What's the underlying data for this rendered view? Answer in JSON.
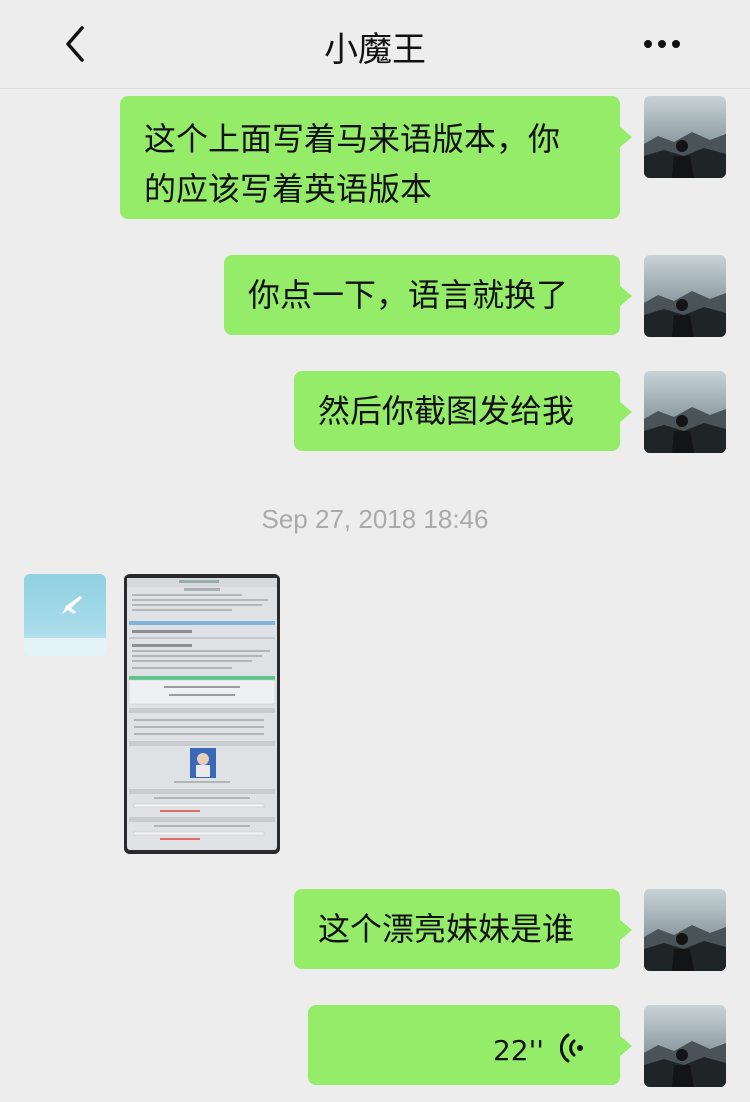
{
  "header": {
    "title": "小魔王"
  },
  "messages": {
    "m1": {
      "line1": "这个上面写着马来语版本，你",
      "line2": "的应该写着英语版本"
    },
    "m2": {
      "text": "你点一下，语言就换了"
    },
    "m3": {
      "text": "然后你截图发给我"
    },
    "timestamp": "Sep 27, 2018 18:46",
    "m5": {
      "text": "这个漂亮妹妹是谁"
    },
    "voice": {
      "duration": "22''"
    }
  },
  "icons": {
    "back": "chevron-left-icon",
    "more": "more-dots-icon",
    "voice": "voice-wave-icon"
  },
  "colors": {
    "background": "#ededed",
    "bubble_sent": "#95ec69",
    "timestamp": "#aaaaaa"
  }
}
